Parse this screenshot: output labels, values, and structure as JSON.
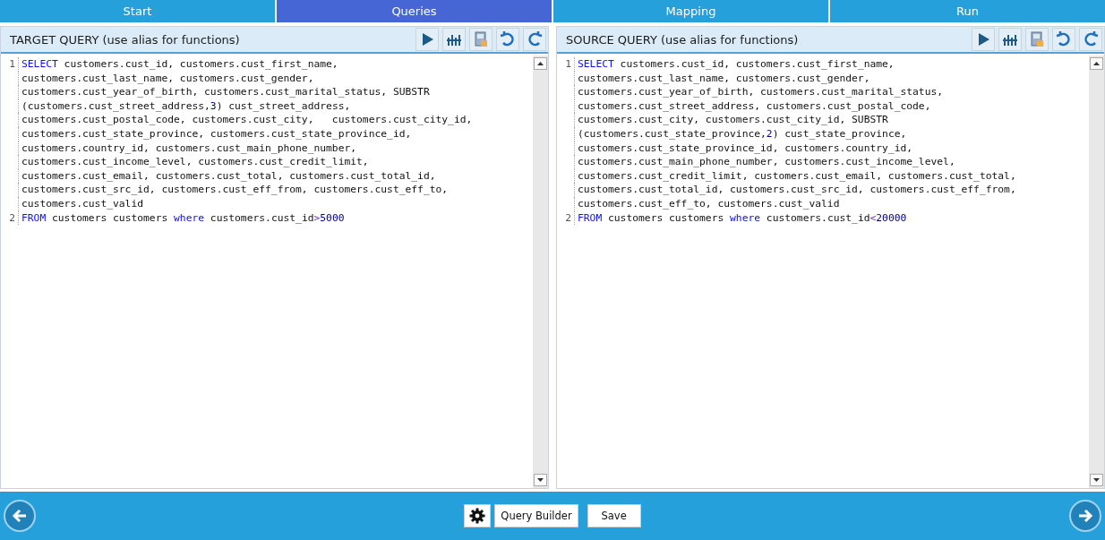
{
  "tabs": [
    {
      "label": "Start",
      "selected": false
    },
    {
      "label": "Queries",
      "selected": true
    },
    {
      "label": "Mapping",
      "selected": false
    },
    {
      "label": "Run",
      "selected": false
    }
  ],
  "panels": [
    {
      "title": "TARGET QUERY (use alias for functions)",
      "lines": [
        {
          "number": "1",
          "rows": [
            [
              {
                "kind": "keyword",
                "text": "SELECT"
              },
              {
                "kind": "plain",
                "text": " customers.cust_id, customers.cust_first_name,"
              }
            ],
            [
              {
                "kind": "plain",
                "text": "customers.cust_last_name, customers.cust_gender,"
              }
            ],
            [
              {
                "kind": "plain",
                "text": "customers.cust_year_of_birth, customers.cust_marital_status, SUBSTR"
              }
            ],
            [
              {
                "kind": "plain",
                "text": "(customers.cust_street_address,"
              },
              {
                "kind": "number",
                "text": "3"
              },
              {
                "kind": "plain",
                "text": ") cust_street_address,"
              }
            ],
            [
              {
                "kind": "plain",
                "text": "customers.cust_postal_code, customers.cust_city,   customers.cust_city_id,"
              }
            ],
            [
              {
                "kind": "plain",
                "text": "customers.cust_state_province, customers.cust_state_province_id,"
              }
            ],
            [
              {
                "kind": "plain",
                "text": "customers.country_id, customers.cust_main_phone_number,"
              }
            ],
            [
              {
                "kind": "plain",
                "text": "customers.cust_income_level, customers.cust_credit_limit,"
              }
            ],
            [
              {
                "kind": "plain",
                "text": "customers.cust_email, customers.cust_total, customers.cust_total_id,"
              }
            ],
            [
              {
                "kind": "plain",
                "text": "customers.cust_src_id, customers.cust_eff_from, customers.cust_eff_to,"
              }
            ],
            [
              {
                "kind": "plain",
                "text": "customers.cust_valid"
              }
            ]
          ]
        },
        {
          "number": "2",
          "rows": [
            [
              {
                "kind": "keyword",
                "text": "FROM"
              },
              {
                "kind": "plain",
                "text": " customers customers "
              },
              {
                "kind": "keyword",
                "text": "where"
              },
              {
                "kind": "plain",
                "text": " customers.cust_id"
              },
              {
                "kind": "operator",
                "text": ">"
              },
              {
                "kind": "number",
                "text": "5000"
              }
            ]
          ]
        }
      ]
    },
    {
      "title": "SOURCE QUERY (use alias for functions)",
      "lines": [
        {
          "number": "1",
          "rows": [
            [
              {
                "kind": "keyword",
                "text": "SELECT"
              },
              {
                "kind": "plain",
                "text": " customers.cust_id, customers.cust_first_name,"
              }
            ],
            [
              {
                "kind": "plain",
                "text": "customers.cust_last_name, customers.cust_gender,"
              }
            ],
            [
              {
                "kind": "plain",
                "text": "customers.cust_year_of_birth, customers.cust_marital_status,"
              }
            ],
            [
              {
                "kind": "plain",
                "text": "customers.cust_street_address, customers.cust_postal_code,"
              }
            ],
            [
              {
                "kind": "plain",
                "text": "customers.cust_city, customers.cust_city_id, SUBSTR"
              }
            ],
            [
              {
                "kind": "plain",
                "text": "(customers.cust_state_province,"
              },
              {
                "kind": "number",
                "text": "2"
              },
              {
                "kind": "plain",
                "text": ") cust_state_province,"
              }
            ],
            [
              {
                "kind": "plain",
                "text": "customers.cust_state_province_id, customers.country_id,"
              }
            ],
            [
              {
                "kind": "plain",
                "text": "customers.cust_main_phone_number, customers.cust_income_level,"
              }
            ],
            [
              {
                "kind": "plain",
                "text": "customers.cust_credit_limit, customers.cust_email, customers.cust_total,"
              }
            ],
            [
              {
                "kind": "plain",
                "text": "customers.cust_total_id, customers.cust_src_id, customers.cust_eff_from,"
              }
            ],
            [
              {
                "kind": "plain",
                "text": "customers.cust_eff_to, customers.cust_valid"
              }
            ]
          ]
        },
        {
          "number": "2",
          "rows": [
            [
              {
                "kind": "keyword",
                "text": "FROM"
              },
              {
                "kind": "plain",
                "text": " customers customers "
              },
              {
                "kind": "keyword",
                "text": "where"
              },
              {
                "kind": "plain",
                "text": " customers.cust_id"
              },
              {
                "kind": "operator",
                "text": "<"
              },
              {
                "kind": "number",
                "text": "20000"
              }
            ]
          ]
        }
      ]
    }
  ],
  "footer": {
    "buttons": [
      "Query Builder",
      "Save"
    ]
  }
}
